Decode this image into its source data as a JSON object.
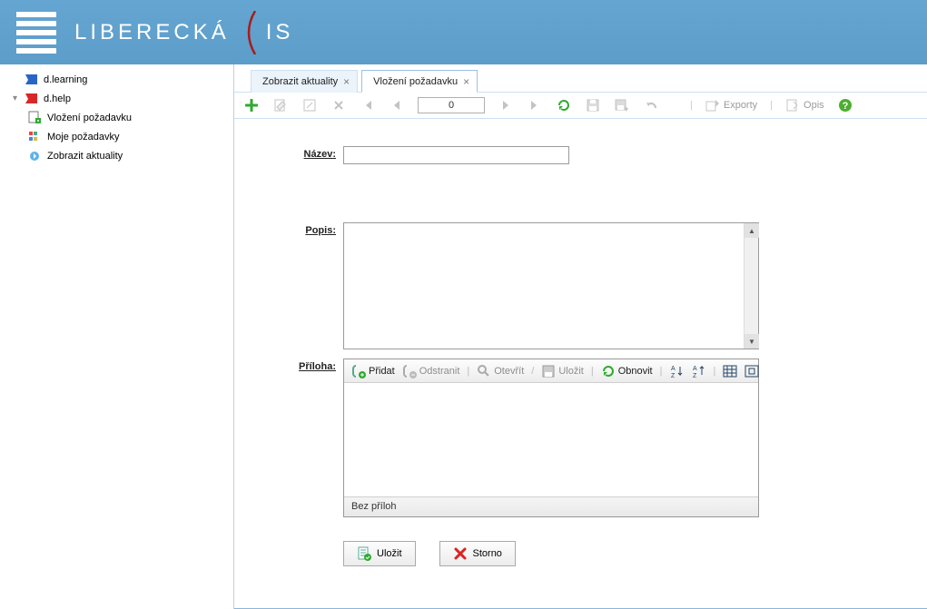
{
  "brand": {
    "text_a": "LIBERECKÁ",
    "text_b": "IS"
  },
  "sidebar": {
    "items": [
      {
        "label": "d.learning",
        "expandable": false
      },
      {
        "label": "d.help",
        "expandable": true,
        "expanded": true,
        "children": [
          {
            "label": "Vložení požadavku"
          },
          {
            "label": "Moje požadavky"
          },
          {
            "label": "Zobrazit aktuality"
          }
        ]
      }
    ]
  },
  "tabs": [
    {
      "label": "Zobrazit aktuality",
      "active": false
    },
    {
      "label": "Vložení požadavku",
      "active": true
    }
  ],
  "main_toolbar": {
    "counter": "0",
    "exporty_label": "Exporty",
    "opis_label": "Opis"
  },
  "form": {
    "nazev_label": "Název:",
    "popis_label": "Popis:",
    "priloha_label": "Příloha:",
    "nazev_value": "",
    "popis_value": ""
  },
  "attach_toolbar": {
    "pridat": "Přidat",
    "odstranit": "Odstranit",
    "otevrit": "Otevřít",
    "ulozit": "Uložit",
    "obnovit": "Obnovit"
  },
  "attach_footer": "Bez příloh",
  "buttons": {
    "save": "Uložit",
    "cancel": "Storno"
  }
}
